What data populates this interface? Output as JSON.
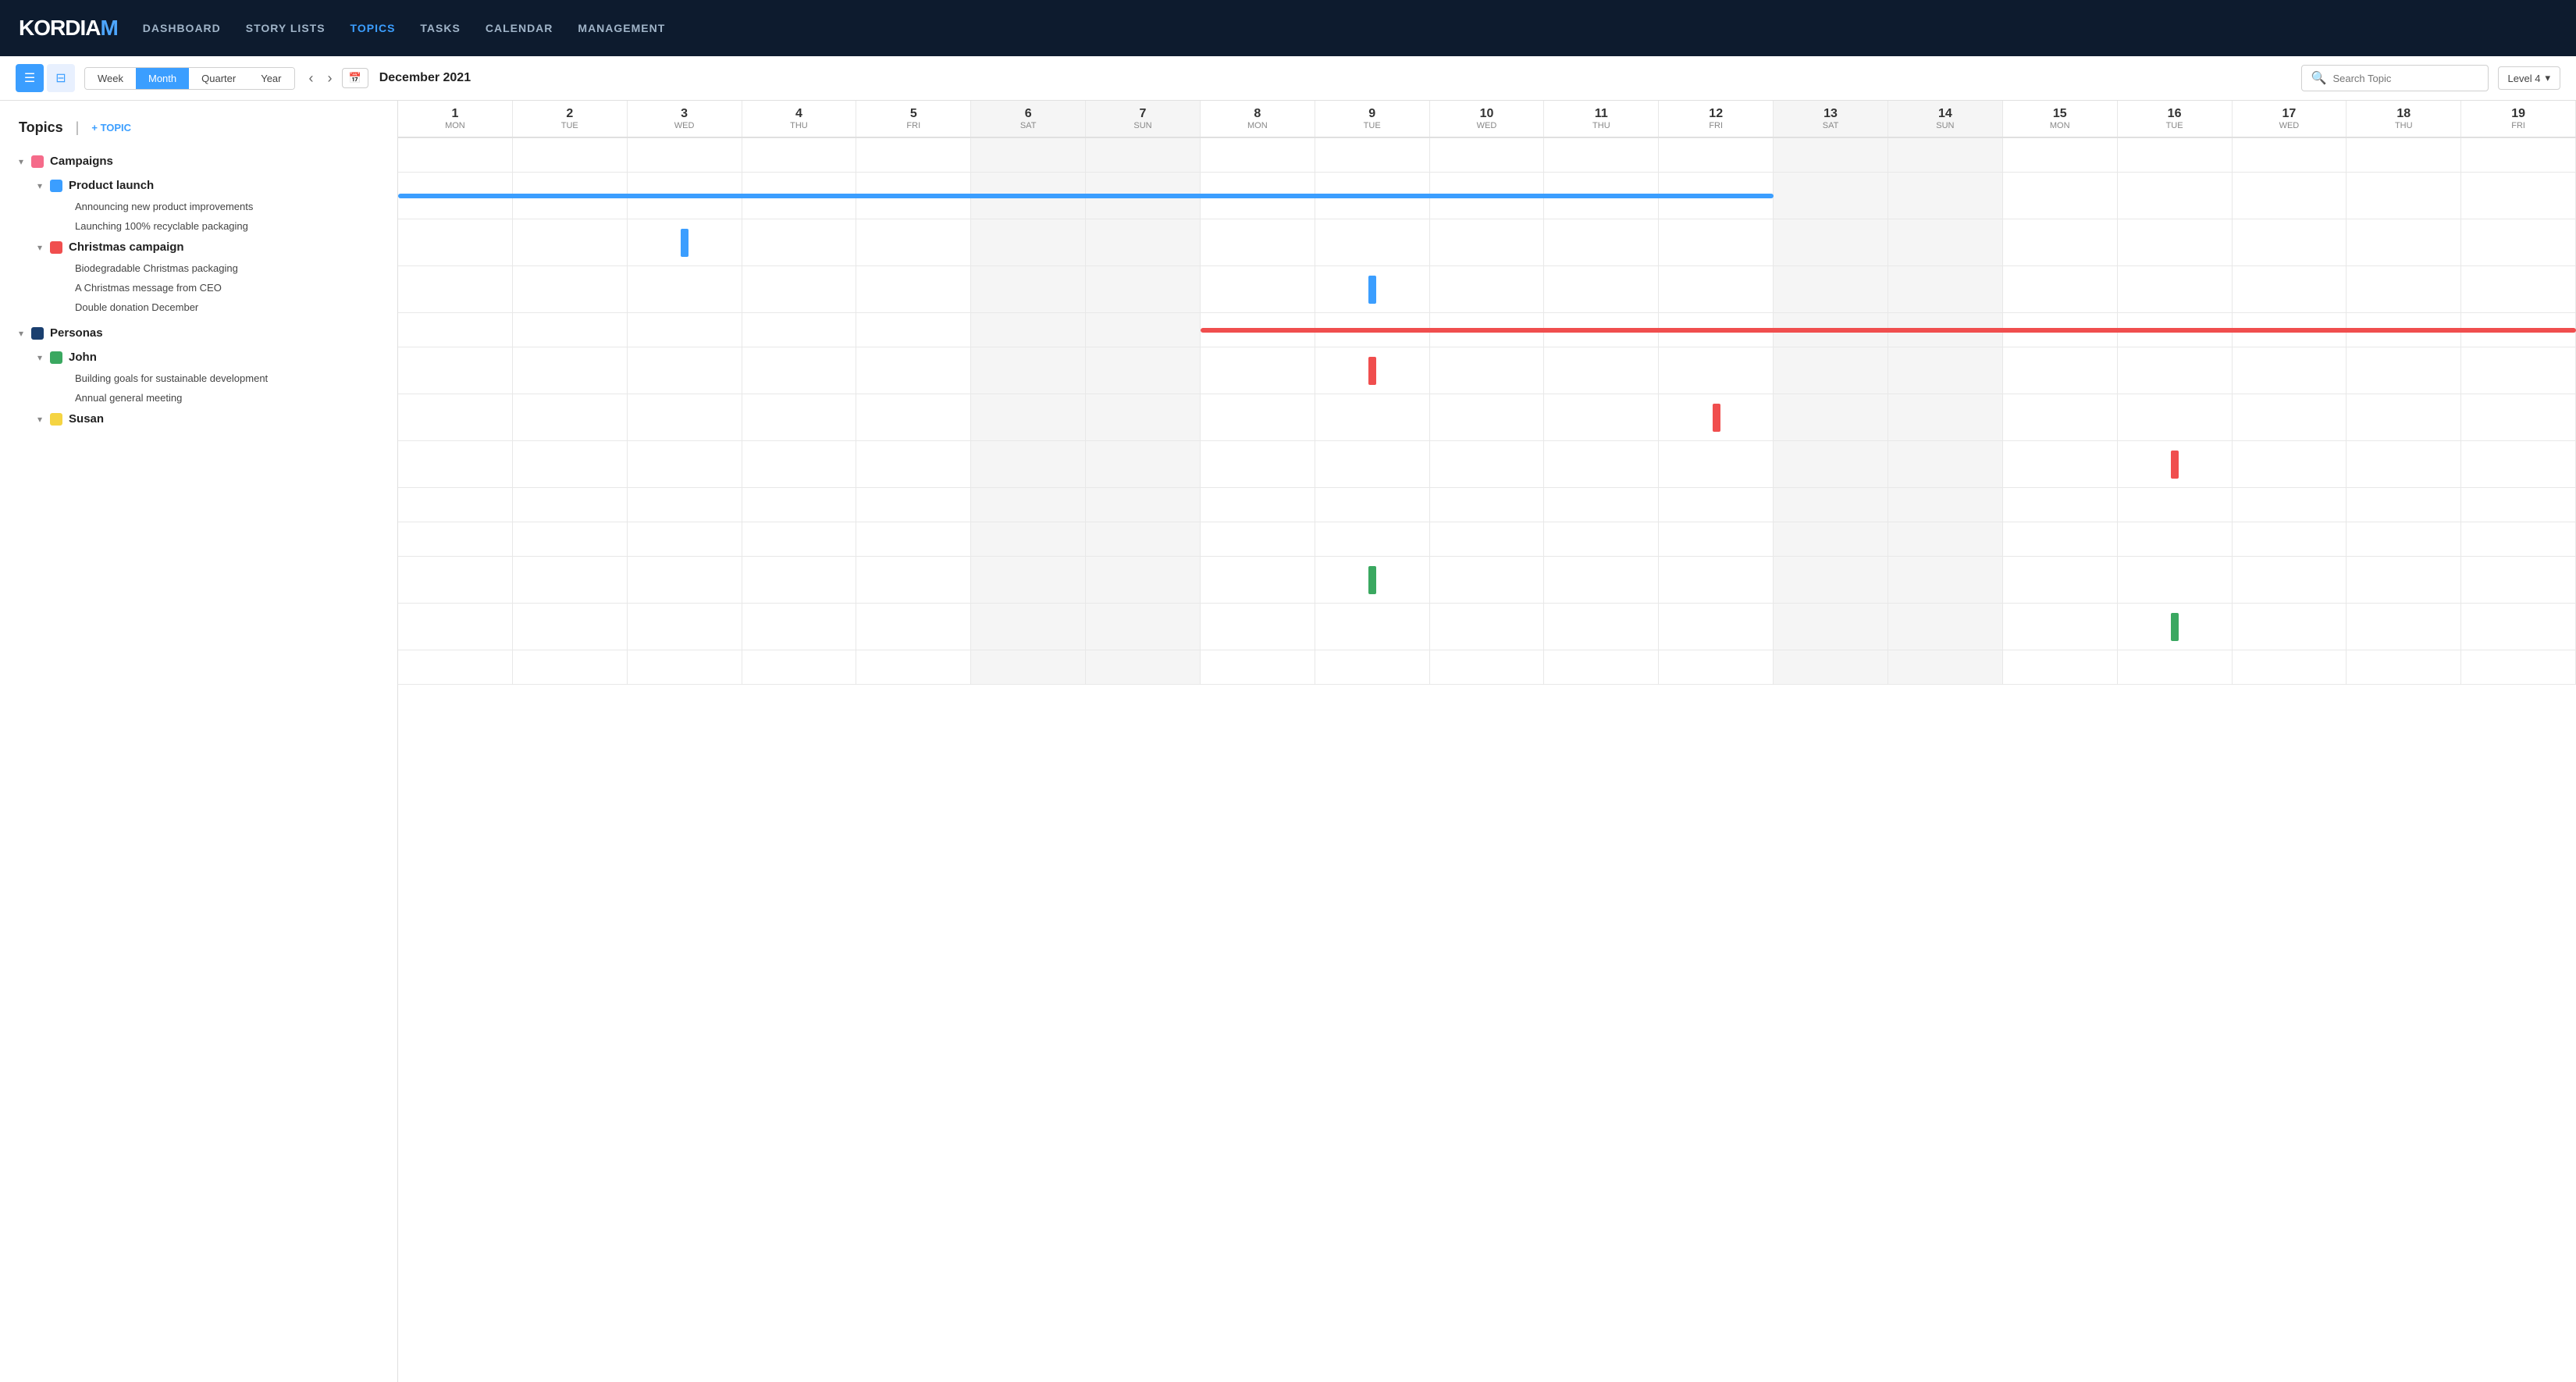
{
  "app": {
    "name": "KORDIAM"
  },
  "nav": {
    "links": [
      {
        "id": "dashboard",
        "label": "DASHBOARD",
        "active": false
      },
      {
        "id": "story-lists",
        "label": "STORY LISTS",
        "active": false
      },
      {
        "id": "topics",
        "label": "TOPICS",
        "active": true
      },
      {
        "id": "tasks",
        "label": "TASKS",
        "active": false
      },
      {
        "id": "calendar",
        "label": "CALENDAR",
        "active": false
      },
      {
        "id": "management",
        "label": "MANAGEMENT",
        "active": false
      }
    ]
  },
  "toolbar": {
    "view_list_label": "☰",
    "view_grid_label": "⊞",
    "period_week": "Week",
    "period_month": "Month",
    "period_quarter": "Quarter",
    "period_year": "Year",
    "active_period": "Month",
    "prev_label": "‹",
    "next_label": "›",
    "today_label": "📅",
    "current_date": "December 2021",
    "search_placeholder": "Search Topic",
    "level_label": "Level 4",
    "chevron_down": "▾"
  },
  "sidebar": {
    "title": "Topics",
    "add_topic": "+ TOPIC",
    "groups": [
      {
        "id": "campaigns",
        "label": "Campaigns",
        "color": "pink",
        "expanded": true,
        "sub_groups": [
          {
            "id": "product-launch",
            "label": "Product launch",
            "color": "blue",
            "expanded": true,
            "stories": [
              "Announcing new product improvements",
              "Launching 100% recyclable packaging"
            ]
          },
          {
            "id": "christmas-campaign",
            "label": "Christmas campaign",
            "color": "red",
            "expanded": true,
            "stories": [
              "Biodegradable Christmas packaging",
              "A Christmas message from CEO",
              "Double donation December"
            ]
          }
        ]
      },
      {
        "id": "personas",
        "label": "Personas",
        "color": "navy",
        "expanded": true,
        "sub_groups": [
          {
            "id": "john",
            "label": "John",
            "color": "green",
            "expanded": true,
            "stories": [
              "Building goals for sustainable development",
              "Annual general meeting"
            ]
          },
          {
            "id": "susan",
            "label": "Susan",
            "color": "yellow",
            "expanded": false,
            "stories": []
          }
        ]
      }
    ]
  },
  "calendar": {
    "days": [
      {
        "num": "1",
        "name": "Mon",
        "weekend": false
      },
      {
        "num": "2",
        "name": "Tue",
        "weekend": false
      },
      {
        "num": "3",
        "name": "Wed",
        "weekend": false
      },
      {
        "num": "4",
        "name": "Thu",
        "weekend": false
      },
      {
        "num": "5",
        "name": "Fri",
        "weekend": false
      },
      {
        "num": "6",
        "name": "Sat",
        "weekend": true
      },
      {
        "num": "7",
        "name": "Sun",
        "weekend": true
      },
      {
        "num": "8",
        "name": "Mon",
        "weekend": false
      },
      {
        "num": "9",
        "name": "Tue",
        "weekend": false
      },
      {
        "num": "10",
        "name": "Wed",
        "weekend": false
      },
      {
        "num": "11",
        "name": "Thu",
        "weekend": false
      },
      {
        "num": "12",
        "name": "Fri",
        "weekend": false
      },
      {
        "num": "13",
        "name": "Sat",
        "weekend": true
      },
      {
        "num": "14",
        "name": "Sun",
        "weekend": true
      },
      {
        "num": "15",
        "name": "Mon",
        "weekend": false
      },
      {
        "num": "16",
        "name": "Tue",
        "weekend": false
      },
      {
        "num": "17",
        "name": "Wed",
        "weekend": false
      },
      {
        "num": "18",
        "name": "Thu",
        "weekend": false
      },
      {
        "num": "19",
        "name": "Fri",
        "weekend": false
      }
    ],
    "rows": {
      "campaigns_section_row": 0,
      "product_launch_row": 1,
      "story1_row": 2,
      "story2_row": 3,
      "christmas_section_row": 4,
      "christmas_story1_row": 5,
      "christmas_story2_row": 6,
      "christmas_story3_row": 7,
      "personas_section_row": 8,
      "john_section_row": 9,
      "john_story1_row": 10,
      "john_story2_row": 11,
      "susan_section_row": 12
    }
  }
}
